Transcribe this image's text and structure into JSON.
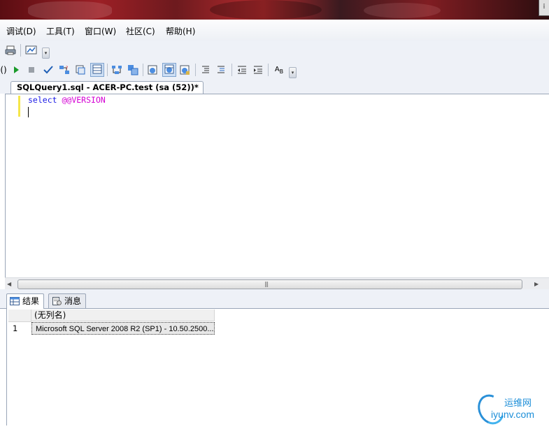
{
  "menu": [
    {
      "label": "调试(D)"
    },
    {
      "label": "工具(T)"
    },
    {
      "label": "窗口(W)"
    },
    {
      "label": "社区(C)"
    },
    {
      "label": "帮助(H)"
    }
  ],
  "toolbar2": {
    "partial_left": "()",
    "ab_label": "A",
    "ab_sub": "B"
  },
  "document_tab": {
    "title": "SQLQuery1.sql - ACER-PC.test (sa (52))*"
  },
  "editor": {
    "keyword": "select",
    "system_variable": "@@VERSION"
  },
  "results_tabs": {
    "results_label": "结果",
    "messages_label": "消息"
  },
  "results_grid": {
    "columns": [
      "(无列名)"
    ],
    "rows": [
      {
        "row_number": "1",
        "values": [
          "Microsoft SQL Server 2008 R2 (SP1) - 10.50.2500..."
        ]
      }
    ]
  },
  "watermark": {
    "chinese": "运维网",
    "domain": "iyunv.com"
  },
  "colors": {
    "keyword": "#1a1ae6",
    "system_variable": "#d400d4",
    "margin_marker": "#f5e64a",
    "watermark": "#1c8ed8"
  }
}
